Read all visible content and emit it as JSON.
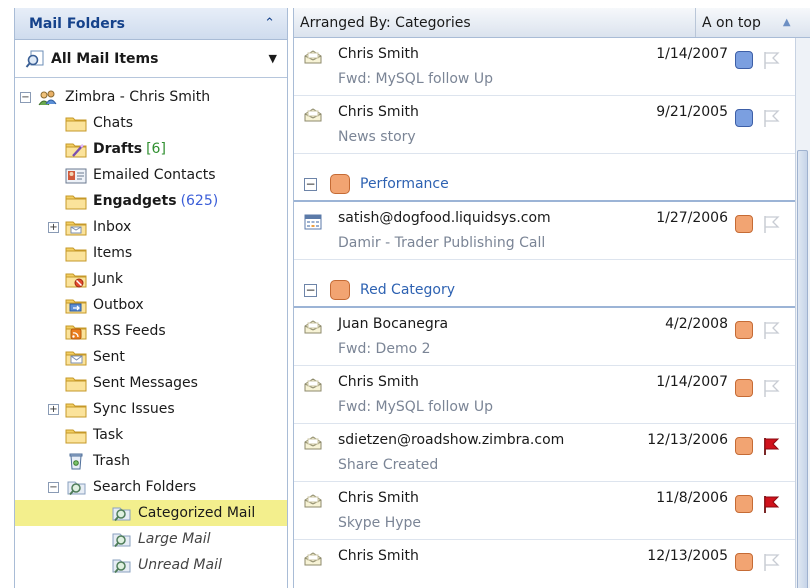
{
  "left_pane": {
    "title": "Mail Folders",
    "view_selector": "All Mail Items",
    "tree": [
      {
        "label": "Zimbra - Chris Smith",
        "level": 0,
        "expander": "minus",
        "icon": "account-icon"
      },
      {
        "label": "Chats",
        "level": 1,
        "icon": "folder-icon"
      },
      {
        "label": "Drafts",
        "count": "[6]",
        "level": 1,
        "bold": true,
        "icon": "drafts-icon"
      },
      {
        "label": "Emailed Contacts",
        "level": 1,
        "icon": "contacts-icon"
      },
      {
        "label": "Engadgets",
        "count": "(625)",
        "level": 1,
        "bold": true,
        "icon": "folder-icon"
      },
      {
        "label": "Inbox",
        "level": 1,
        "expander": "plus",
        "icon": "inbox-icon"
      },
      {
        "label": "Items",
        "level": 1,
        "icon": "folder-icon"
      },
      {
        "label": "Junk",
        "level": 1,
        "icon": "junk-icon"
      },
      {
        "label": "Outbox",
        "level": 1,
        "icon": "outbox-icon"
      },
      {
        "label": "RSS Feeds",
        "level": 1,
        "icon": "rss-icon"
      },
      {
        "label": "Sent",
        "level": 1,
        "icon": "sent-icon"
      },
      {
        "label": "Sent Messages",
        "level": 1,
        "icon": "folder-icon"
      },
      {
        "label": "Sync Issues",
        "level": 1,
        "expander": "plus",
        "icon": "folder-icon"
      },
      {
        "label": "Task",
        "level": 1,
        "icon": "folder-icon"
      },
      {
        "label": "Trash",
        "level": 1,
        "icon": "trash-icon"
      },
      {
        "label": "Search Folders",
        "level": 1,
        "expander": "minus",
        "icon": "search-folder-icon"
      },
      {
        "label": "Categorized Mail",
        "level": 2,
        "selected": true,
        "icon": "search-folder-icon"
      },
      {
        "label": "Large Mail",
        "level": 2,
        "italic": true,
        "icon": "search-folder-icon"
      },
      {
        "label": "Unread Mail",
        "level": 2,
        "italic": true,
        "icon": "search-folder-icon"
      }
    ]
  },
  "right_pane": {
    "arranged_by": "Arranged By: Categories",
    "sort_order": "A on top",
    "items": [
      {
        "kind": "mail",
        "from": "Chris Smith",
        "subject": "Fwd: MySQL follow Up",
        "date": "1/14/2007",
        "category_color": "#7b9fe0",
        "flagged": false
      },
      {
        "kind": "mail",
        "from": "Chris Smith",
        "subject": "News story",
        "date": "9/21/2005",
        "category_color": "#7b9fe0",
        "flagged": false
      },
      {
        "kind": "group",
        "label": "Performance",
        "category_color": "#f2a472"
      },
      {
        "kind": "mail",
        "from": "satish@dogfood.liquidsys.com",
        "subject": "Damir - Trader Publishing Call",
        "date": "1/27/2006",
        "category_color": "#f2a472",
        "flagged": false,
        "icon": "calendar-icon"
      },
      {
        "kind": "group",
        "label": "Red Category",
        "category_color": "#f2a472"
      },
      {
        "kind": "mail",
        "from": "Juan Bocanegra",
        "subject": "Fwd: Demo 2",
        "date": "4/2/2008",
        "category_color": "#f2a472",
        "flagged": false
      },
      {
        "kind": "mail",
        "from": "Chris Smith",
        "subject": "Fwd: MySQL follow Up",
        "date": "1/14/2007",
        "category_color": "#f2a472",
        "flagged": false
      },
      {
        "kind": "mail",
        "from": "sdietzen@roadshow.zimbra.com",
        "subject": "Share Created",
        "date": "12/13/2006",
        "category_color": "#f2a472",
        "flagged": true
      },
      {
        "kind": "mail",
        "from": "Chris Smith",
        "subject": "Skype Hype",
        "date": "11/8/2006",
        "category_color": "#f2a472",
        "flagged": true
      },
      {
        "kind": "mail",
        "from": "Chris Smith",
        "subject": "",
        "date": "12/13/2005",
        "category_color": "#f2a472",
        "flagged": false
      }
    ]
  },
  "colors": {
    "header_text": "#15428b",
    "selected_bg": "#f3ef8d",
    "flag_red": "#d0121c",
    "group_label": "#2e62b2"
  }
}
